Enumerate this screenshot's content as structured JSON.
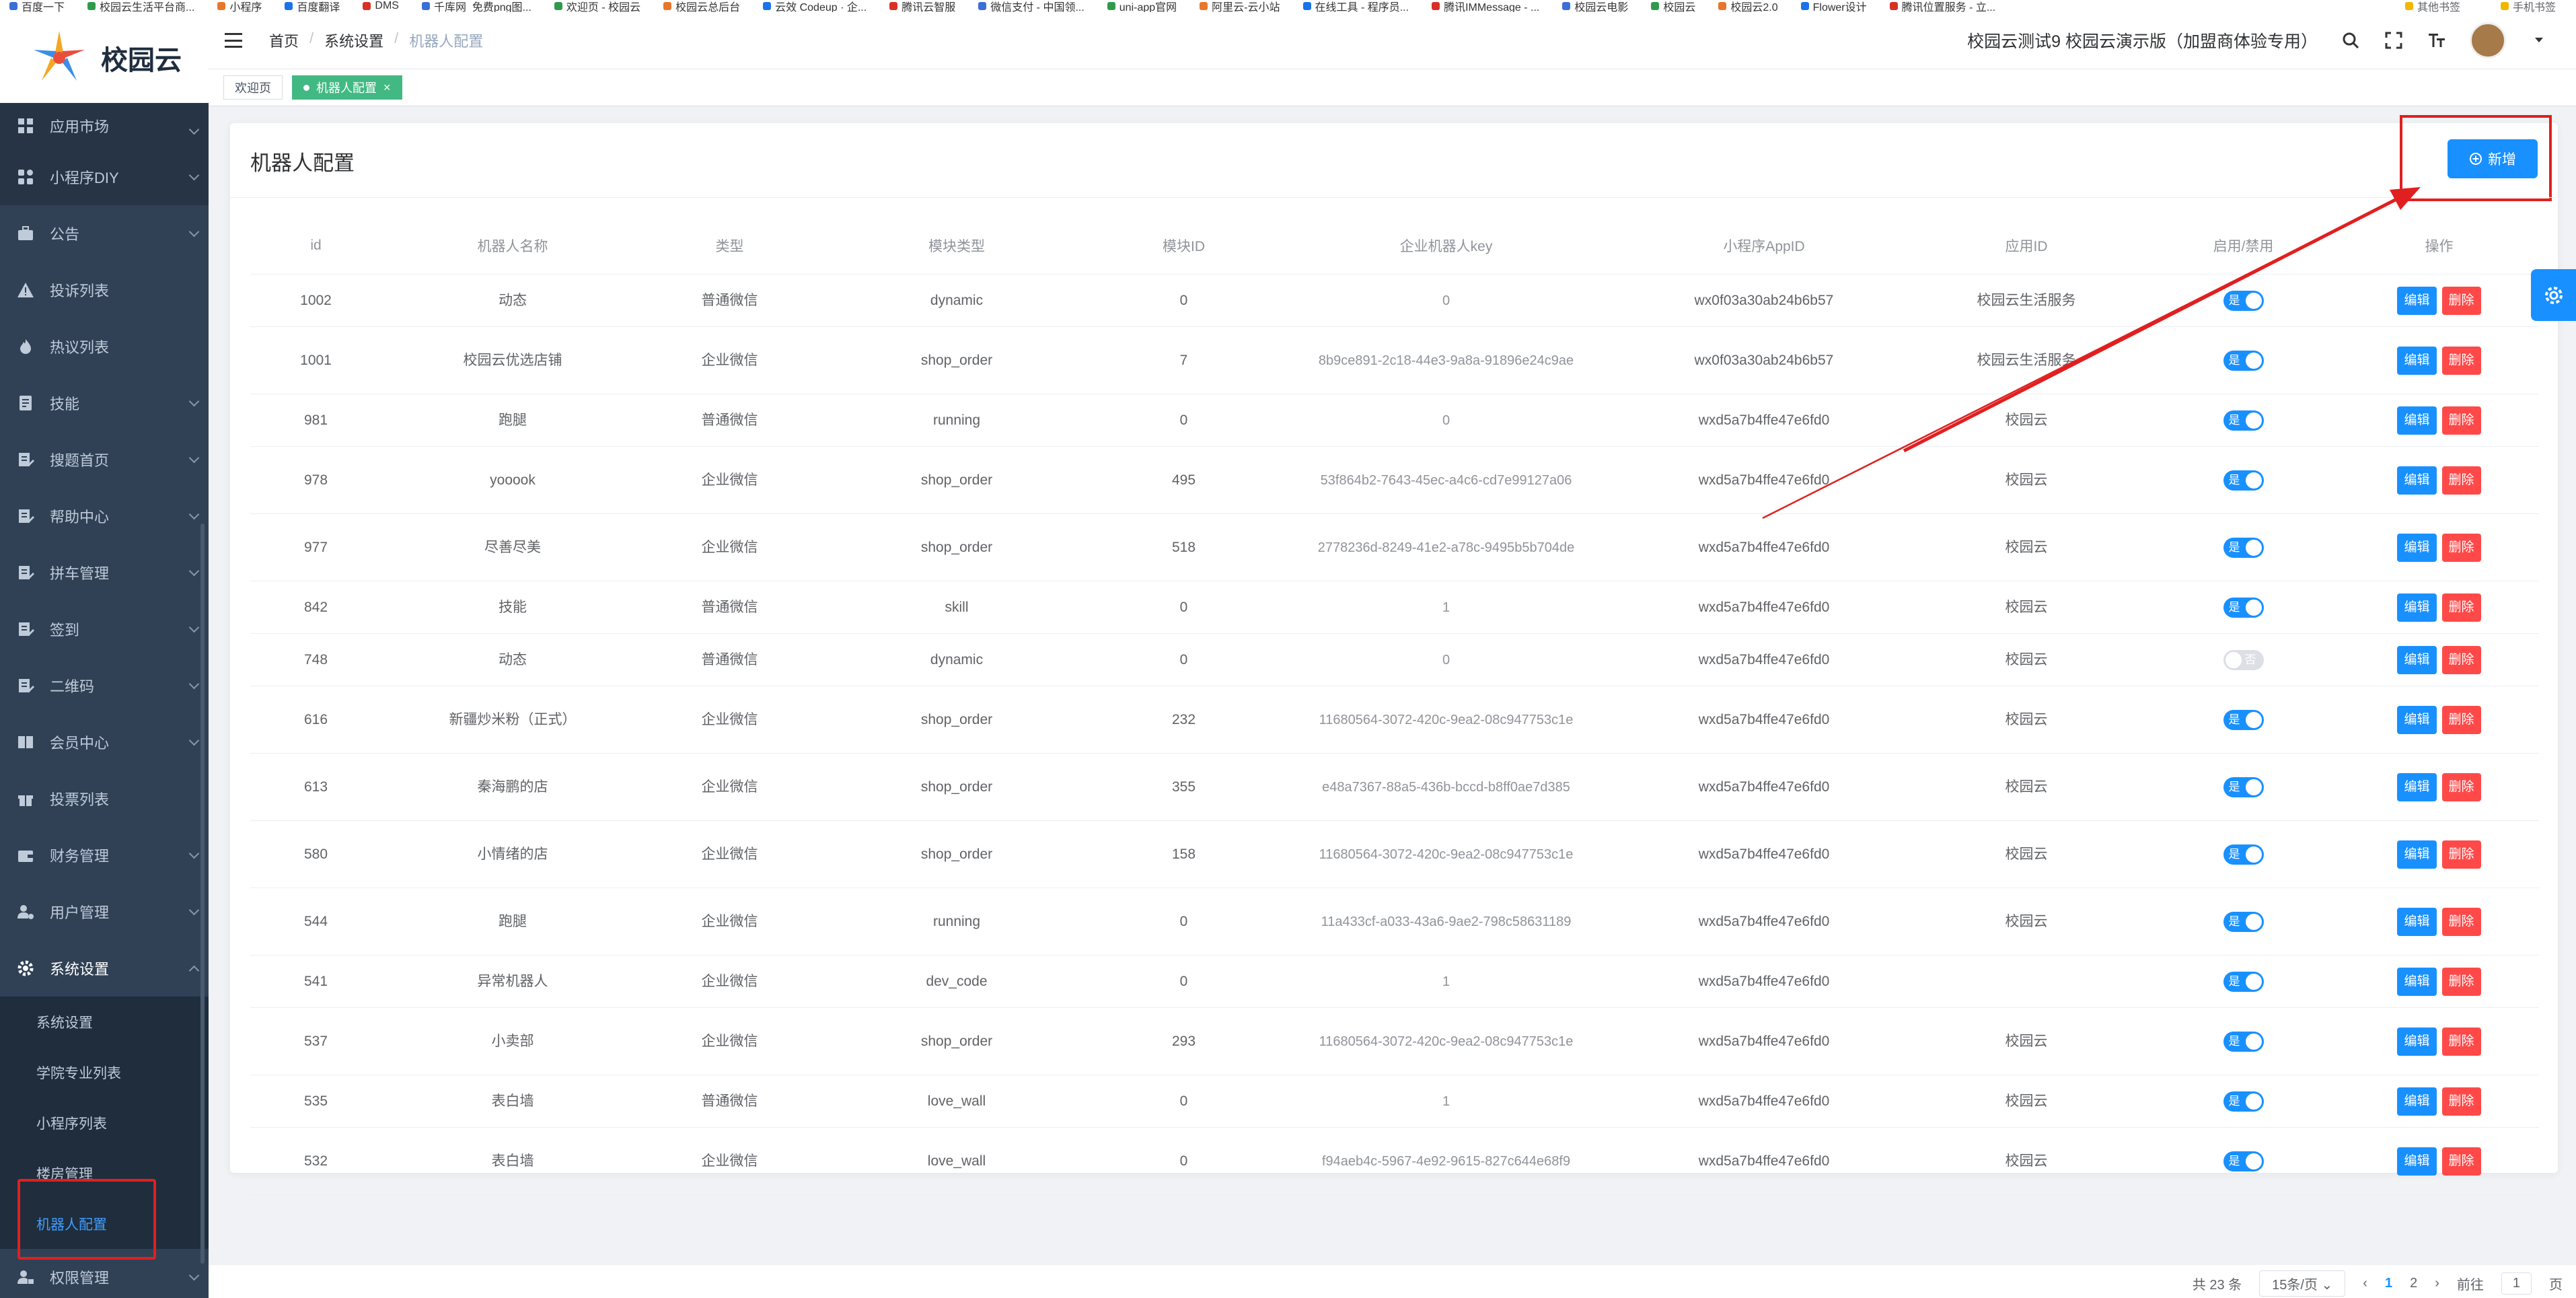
{
  "bookmarks": [
    "百度一下",
    "校园云生活平台商...",
    "小程序",
    "百度翻译",
    "DMS",
    "千库网_免费png图...",
    "欢迎页 - 校园云",
    "校园云总后台",
    "云效 Codeup · 企...",
    "腾讯云智服",
    "微信支付 - 中国领...",
    "uni-app官网",
    "阿里云-云小站",
    "在线工具 - 程序员...",
    "腾讯IMMessage - ...",
    "校园云电影",
    "校园云",
    "校园云2.0",
    "Flower设计",
    "腾讯位置服务 - 立..."
  ],
  "bookmarks_right": [
    "其他书签",
    "手机书签"
  ],
  "logo": {
    "text": "校园云"
  },
  "sidebar": {
    "items": [
      {
        "label": "应用市场",
        "icon": "grid-icon"
      },
      {
        "label": "小程序DIY",
        "icon": "apps-icon"
      },
      {
        "label": "公告",
        "icon": "briefcase-icon"
      },
      {
        "label": "投诉列表",
        "icon": "warning-icon"
      },
      {
        "label": "热议列表",
        "icon": "flame-icon"
      },
      {
        "label": "技能",
        "icon": "skill-icon"
      },
      {
        "label": "搜题首页",
        "icon": "edit-icon"
      },
      {
        "label": "帮助中心",
        "icon": "edit-icon"
      },
      {
        "label": "拼车管理",
        "icon": "edit-icon"
      },
      {
        "label": "签到",
        "icon": "edit-icon"
      },
      {
        "label": "二维码",
        "icon": "edit-icon"
      },
      {
        "label": "会员中心",
        "icon": "book-icon"
      },
      {
        "label": "投票列表",
        "icon": "gift-icon"
      },
      {
        "label": "财务管理",
        "icon": "wallet-icon"
      },
      {
        "label": "用户管理",
        "icon": "user-gear-icon"
      },
      {
        "label": "系统设置",
        "icon": "gear-icon"
      }
    ],
    "submenu": [
      "系统设置",
      "学院专业列表",
      "小程序列表",
      "楼房管理",
      "机器人配置"
    ],
    "last_item": {
      "label": "权限管理",
      "icon": "user-lock-icon"
    }
  },
  "breadcrumb": [
    "首页",
    "系统设置",
    "机器人配置"
  ],
  "header": {
    "title": "校园云测试9 校园云演示版（加盟商体验专用）"
  },
  "tags": {
    "welcome": "欢迎页",
    "active": "机器人配置",
    "close": "×"
  },
  "card": {
    "title": "机器人配置",
    "add_button": "新增"
  },
  "table": {
    "columns": [
      "id",
      "机器人名称",
      "类型",
      "模块类型",
      "模块ID",
      "企业机器人key",
      "小程序AppID",
      "应用ID",
      "启用/禁用",
      "操作"
    ],
    "rows": [
      {
        "id": "1002",
        "name": "动态",
        "type": "普通微信",
        "module": "dynamic",
        "module_id": "0",
        "key": "0",
        "appid": "wx0f03a30ab24b6b57",
        "app": "校园云生活服务",
        "enabled": true
      },
      {
        "id": "1001",
        "name": "校园云优选店铺",
        "type": "企业微信",
        "module": "shop_order",
        "module_id": "7",
        "key": "8b9ce891-2c18-44e3-9a8a-91896e24c9ae",
        "appid": "wx0f03a30ab24b6b57",
        "app": "校园云生活服务",
        "enabled": true
      },
      {
        "id": "981",
        "name": "跑腿",
        "type": "普通微信",
        "module": "running",
        "module_id": "0",
        "key": "0",
        "appid": "wxd5a7b4ffe47e6fd0",
        "app": "校园云",
        "enabled": true
      },
      {
        "id": "978",
        "name": "yooook",
        "type": "企业微信",
        "module": "shop_order",
        "module_id": "495",
        "key": "53f864b2-7643-45ec-a4c6-cd7e99127a06",
        "appid": "wxd5a7b4ffe47e6fd0",
        "app": "校园云",
        "enabled": true
      },
      {
        "id": "977",
        "name": "尽善尽美",
        "type": "企业微信",
        "module": "shop_order",
        "module_id": "518",
        "key": "2778236d-8249-41e2-a78c-9495b5b704de",
        "appid": "wxd5a7b4ffe47e6fd0",
        "app": "校园云",
        "enabled": true
      },
      {
        "id": "842",
        "name": "技能",
        "type": "普通微信",
        "module": "skill",
        "module_id": "0",
        "key": "1",
        "appid": "wxd5a7b4ffe47e6fd0",
        "app": "校园云",
        "enabled": true
      },
      {
        "id": "748",
        "name": "动态",
        "type": "普通微信",
        "module": "dynamic",
        "module_id": "0",
        "key": "0",
        "appid": "wxd5a7b4ffe47e6fd0",
        "app": "校园云",
        "enabled": false
      },
      {
        "id": "616",
        "name": "新疆炒米粉（正式）",
        "type": "企业微信",
        "module": "shop_order",
        "module_id": "232",
        "key": "11680564-3072-420c-9ea2-08c947753c1e",
        "appid": "wxd5a7b4ffe47e6fd0",
        "app": "校园云",
        "enabled": true
      },
      {
        "id": "613",
        "name": "秦海鹏的店",
        "type": "企业微信",
        "module": "shop_order",
        "module_id": "355",
        "key": "e48a7367-88a5-436b-bccd-b8ff0ae7d385",
        "appid": "wxd5a7b4ffe47e6fd0",
        "app": "校园云",
        "enabled": true
      },
      {
        "id": "580",
        "name": "小情绪的店",
        "type": "企业微信",
        "module": "shop_order",
        "module_id": "158",
        "key": "11680564-3072-420c-9ea2-08c947753c1e",
        "appid": "wxd5a7b4ffe47e6fd0",
        "app": "校园云",
        "enabled": true
      },
      {
        "id": "544",
        "name": "跑腿",
        "type": "企业微信",
        "module": "running",
        "module_id": "0",
        "key": "11a433cf-a033-43a6-9ae2-798c58631189",
        "appid": "wxd5a7b4ffe47e6fd0",
        "app": "校园云",
        "enabled": true
      },
      {
        "id": "541",
        "name": "异常机器人",
        "type": "企业微信",
        "module": "dev_code",
        "module_id": "0",
        "key": "1",
        "appid": "wxd5a7b4ffe47e6fd0",
        "app": "",
        "enabled": true
      },
      {
        "id": "537",
        "name": "小卖部",
        "type": "企业微信",
        "module": "shop_order",
        "module_id": "293",
        "key": "11680564-3072-420c-9ea2-08c947753c1e",
        "appid": "wxd5a7b4ffe47e6fd0",
        "app": "校园云",
        "enabled": true
      },
      {
        "id": "535",
        "name": "表白墙",
        "type": "普通微信",
        "module": "love_wall",
        "module_id": "0",
        "key": "1",
        "appid": "wxd5a7b4ffe47e6fd0",
        "app": "校园云",
        "enabled": true
      },
      {
        "id": "532",
        "name": "表白墙",
        "type": "企业微信",
        "module": "love_wall",
        "module_id": "0",
        "key": "f94aeb4c-5967-4e92-9615-827c644e68f9",
        "appid": "wxd5a7b4ffe47e6fd0",
        "app": "校园云",
        "enabled": true
      }
    ],
    "switch_on": "是",
    "switch_off": "否",
    "edit_label": "编辑",
    "delete_label": "删除"
  },
  "pagination": {
    "total": "共 23 条",
    "page_size": "15条/页",
    "pages": [
      "1",
      "2"
    ],
    "current": "1",
    "goto_label": "前往",
    "goto_value": "1",
    "page_suffix": "页"
  },
  "colors": {
    "primary": "#1890ff",
    "danger": "#ff4949",
    "sidebar_bg": "#304156",
    "tag_active": "#42b983",
    "annotation": "#e02020"
  }
}
